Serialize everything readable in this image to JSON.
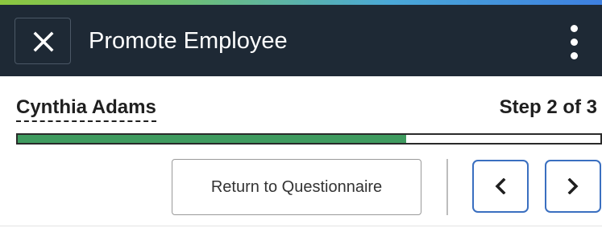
{
  "header": {
    "title": "Promote Employee",
    "close_icon": "close-icon",
    "menu_icon": "kebab-menu-icon"
  },
  "employee": {
    "name": "Cynthia Adams"
  },
  "progress": {
    "step_label": "Step 2 of 3",
    "fraction": 0.667
  },
  "actions": {
    "return_label": "Return to Questionnaire",
    "prev_icon": "chevron-left-icon",
    "next_icon": "chevron-right-icon"
  },
  "colors": {
    "header_background": "#1e2935",
    "progress_fill": "#3f9b5f",
    "nav_border": "#3a6fc0"
  }
}
